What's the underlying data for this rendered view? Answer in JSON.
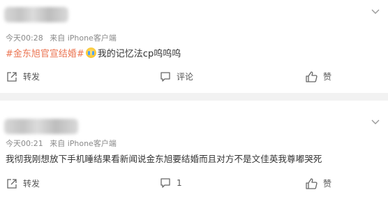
{
  "posts": [
    {
      "timestamp": "今天00:28",
      "source": "来自 iPhone客户端",
      "hashtag": "#金东旭官宣结婚#",
      "text": "我的记忆法cp呜呜呜",
      "emoji_icon": "crying-emoji-icon",
      "actions": {
        "repost": "转发",
        "comment": "评论",
        "like": "赞"
      }
    },
    {
      "timestamp": "今天00:21",
      "source": "来自 iPhone客户端",
      "text": "我彻我刚想放下手机睡结果看新闻说金东旭要结婚而且对方不是文佳英我尊嘟哭死",
      "actions": {
        "repost": "转发",
        "comment_count": "1",
        "like": "赞"
      }
    }
  ],
  "colors": {
    "hashtag": "#eb7350",
    "meta": "#8a8a8a",
    "separator": "#f2f2f2"
  }
}
